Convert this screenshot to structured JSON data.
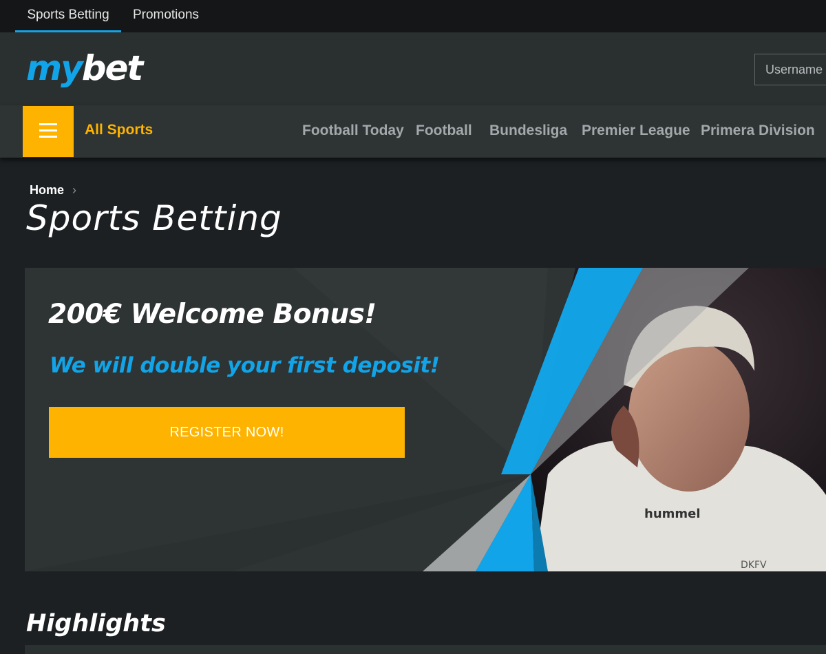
{
  "top_tabs": [
    {
      "label": "Sports Betting",
      "active": true
    },
    {
      "label": "Promotions",
      "active": false
    }
  ],
  "header": {
    "logo_my": "my",
    "logo_bet": "bet",
    "username_placeholder": "Username"
  },
  "sports_nav": {
    "menu_icon": "hamburger-menu-icon",
    "all_sports": "All Sports",
    "links": [
      "Football Today",
      "Football",
      "Bundesliga",
      "Premier League",
      "Primera Division"
    ]
  },
  "breadcrumb": {
    "home": "Home",
    "separator_icon": "chevron-right-icon"
  },
  "page_title": "Sports Betting",
  "banner": {
    "title": "200€ Welcome Bonus!",
    "subtitle": "We will double your first deposit!",
    "cta": "REGISTER NOW!",
    "image_subject": "footballer in white hummel jersey",
    "jersey_text": "hummel",
    "badge_text": "DKFV"
  },
  "highlights": {
    "title": "Highlights"
  },
  "colors": {
    "accent_blue": "#12a4e8",
    "accent_yellow": "#fdb300",
    "background": "#1c2022",
    "panel": "#2e3334"
  }
}
